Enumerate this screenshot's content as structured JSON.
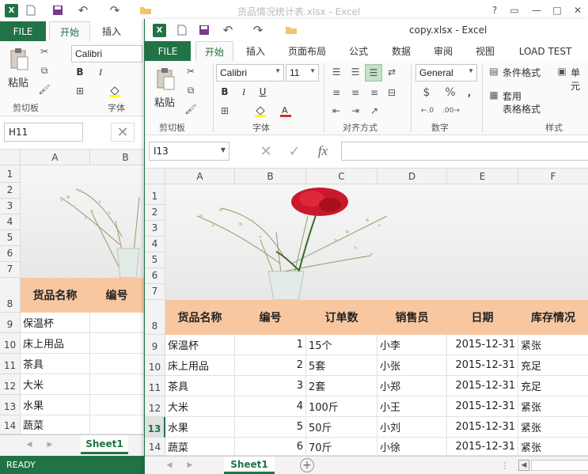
{
  "back_window": {
    "title": "货品情况统计表.xlsx - Excel",
    "tabs": {
      "file": "FILE",
      "home": "开始",
      "insert": "插入"
    },
    "ribbon": {
      "paste": "粘贴",
      "font_name": "Calibri",
      "clipboard_group": "剪切板",
      "font_group": "字体"
    },
    "name_box": "H11",
    "columns": [
      "A",
      "B"
    ],
    "rows": [
      "1",
      "2",
      "3",
      "4",
      "5",
      "6",
      "7",
      "8",
      "9",
      "10",
      "11",
      "12",
      "13",
      "14"
    ],
    "header_cells": [
      "货品名称",
      "编号"
    ],
    "col_a_values": [
      "保温杯",
      "床上用品",
      "茶具",
      "大米",
      "水果",
      "蔬菜"
    ],
    "sheet_tab": "Sheet1",
    "status": "READY"
  },
  "front_window": {
    "title": "copy.xlsx - Excel",
    "tabs": [
      "FILE",
      "开始",
      "插入",
      "页面布局",
      "公式",
      "数据",
      "审阅",
      "视图",
      "LOAD TEST"
    ],
    "active_tab": "开始",
    "ribbon": {
      "paste": "粘贴",
      "font_name": "Calibri",
      "font_size": "11",
      "number_format": "General",
      "conditional_format": "条件格式",
      "table_format_1": "套用",
      "table_format_2": "表格格式",
      "cell": "单元",
      "groups": {
        "clipboard": "剪切板",
        "font": "字体",
        "alignment": "对齐方式",
        "number": "数字",
        "styles": "样式"
      }
    },
    "name_box": "I13",
    "formula": "",
    "columns": [
      "A",
      "B",
      "C",
      "D",
      "E",
      "F"
    ],
    "rows": [
      "1",
      "2",
      "3",
      "4",
      "5",
      "6",
      "7",
      "8",
      "9",
      "10",
      "11",
      "12",
      "13",
      "14"
    ],
    "active_row": "13",
    "table": {
      "headers": [
        "货品名称",
        "编号",
        "订单数",
        "销售员",
        "日期",
        "库存情况"
      ],
      "rows": [
        [
          "保温杯",
          "1",
          "15个",
          "小李",
          "2015-12-31",
          "紧张"
        ],
        [
          "床上用品",
          "2",
          "5套",
          "小张",
          "2015-12-31",
          "充足"
        ],
        [
          "茶具",
          "3",
          "2套",
          "小郑",
          "2015-12-31",
          "充足"
        ],
        [
          "大米",
          "4",
          "100斤",
          "小王",
          "2015-12-31",
          "紧张"
        ],
        [
          "水果",
          "5",
          "50斤",
          "小刘",
          "2015-12-31",
          "紧张"
        ],
        [
          "蔬菜",
          "6",
          "70斤",
          "小徐",
          "2015-12-31",
          "紧张"
        ]
      ]
    },
    "sheet_tab": "Sheet1"
  },
  "colors": {
    "excel_green": "#217346",
    "header_fill": "#f8c7a0"
  },
  "icons": [
    "excel-logo",
    "new-file-icon",
    "save-icon",
    "undo-icon",
    "redo-icon",
    "open-folder-icon",
    "help-icon",
    "minimize-icon",
    "restore-icon",
    "close-icon",
    "cut-icon",
    "copy-icon",
    "format-painter-icon",
    "bold-icon",
    "italic-icon",
    "underline-icon",
    "border-icon",
    "fill-color-icon",
    "font-color-icon",
    "align-icon",
    "wrap-icon",
    "merge-icon",
    "currency-icon",
    "percent-icon",
    "cancel-icon",
    "enter-icon",
    "function-icon",
    "add-sheet-icon"
  ]
}
